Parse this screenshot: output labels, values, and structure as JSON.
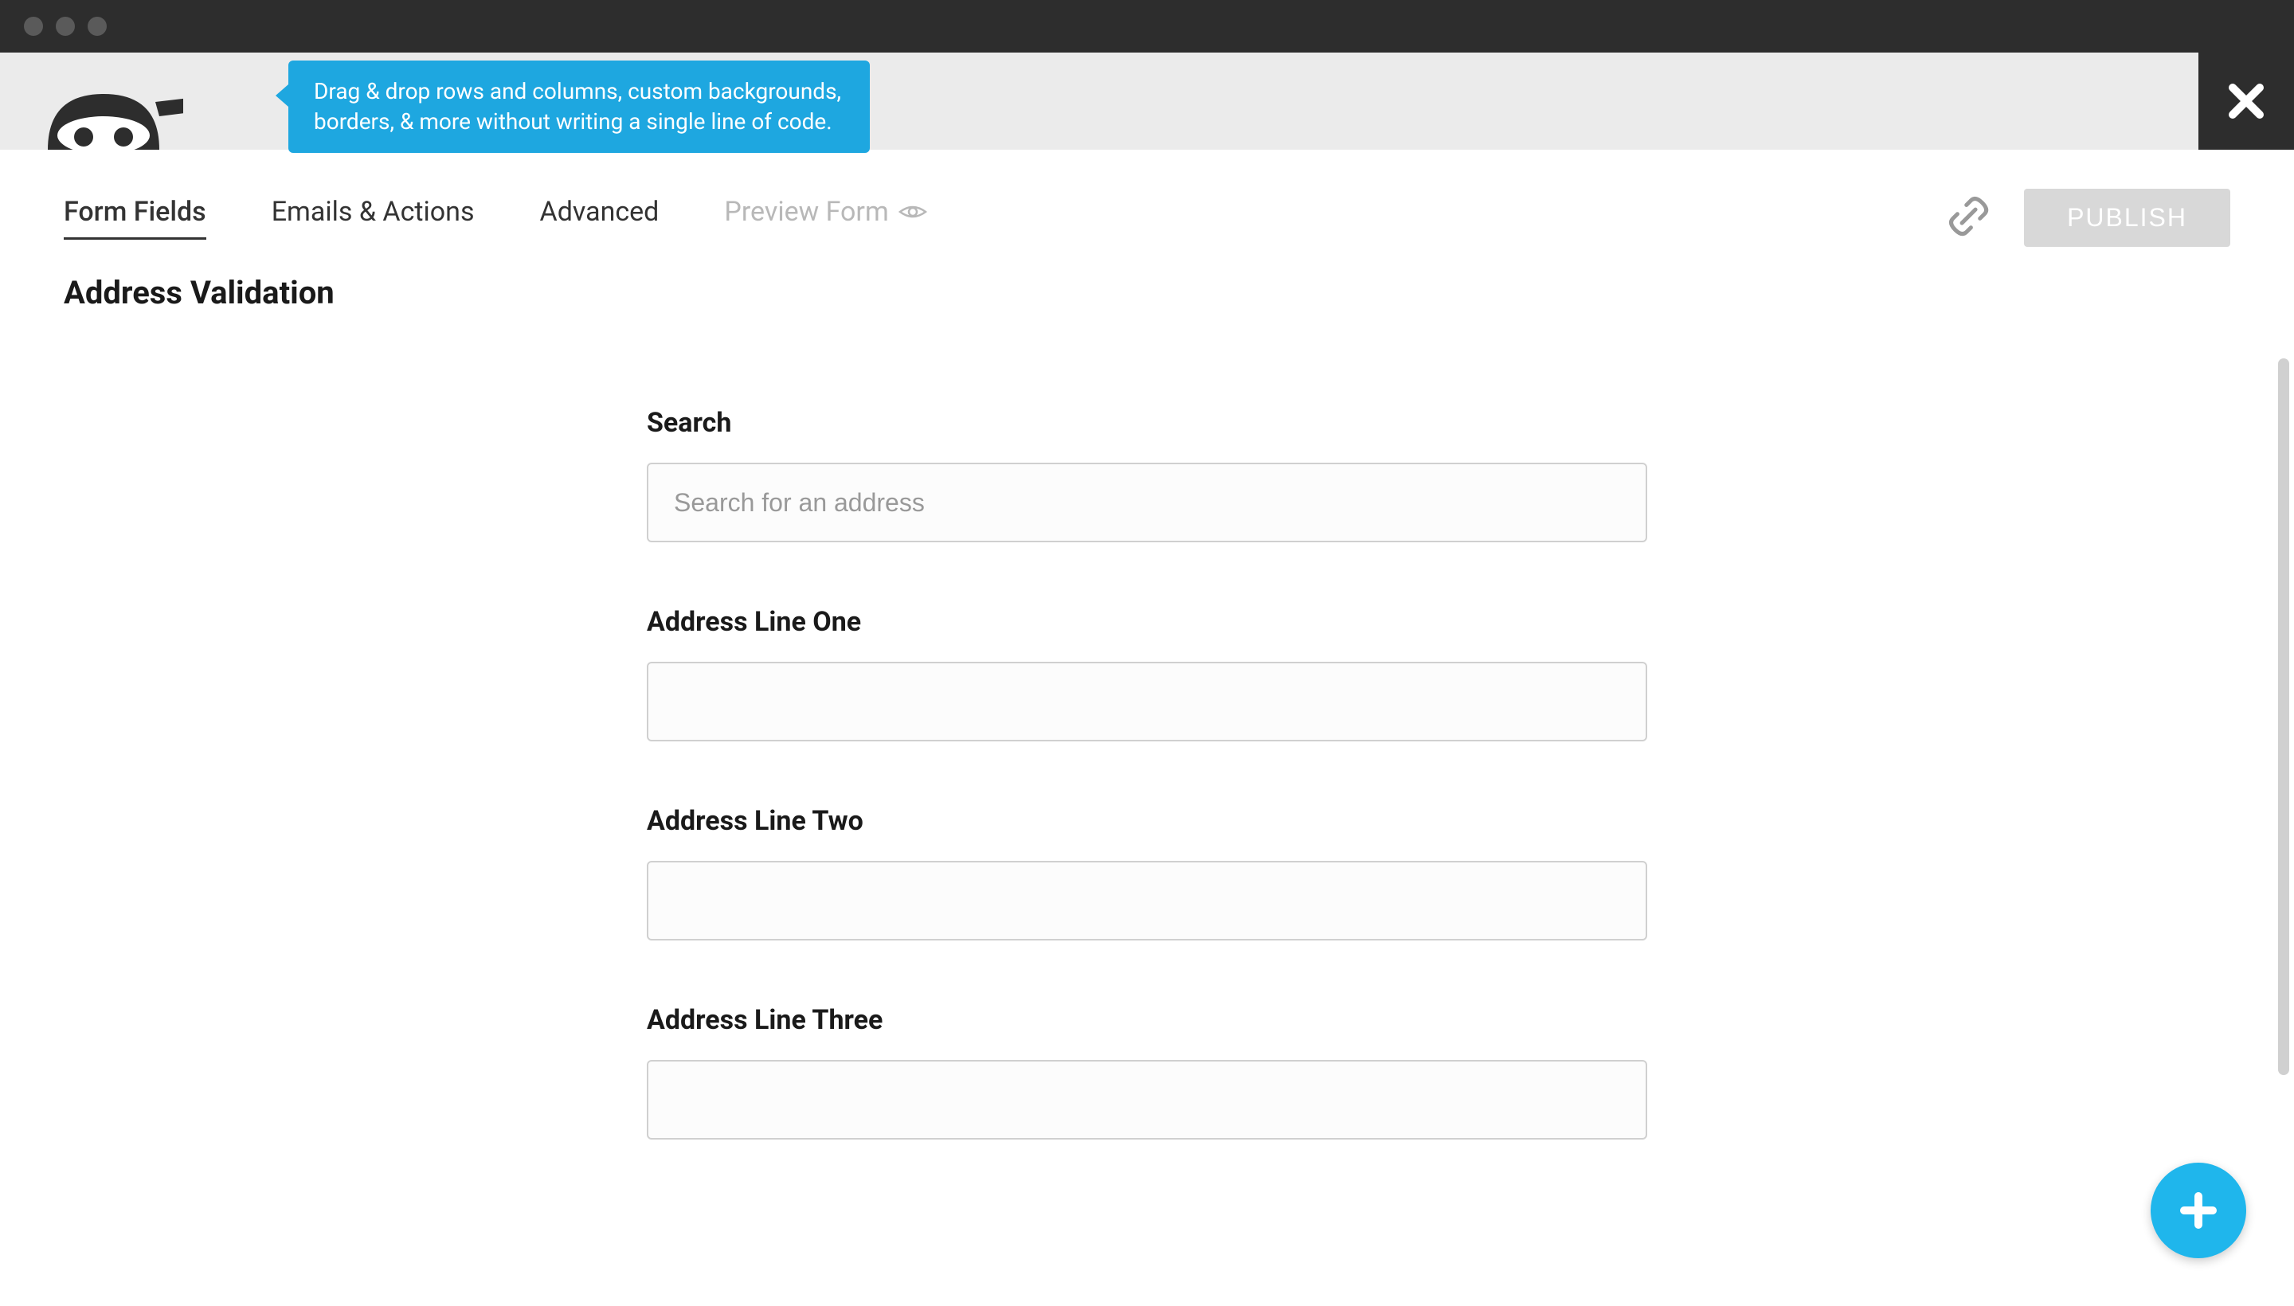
{
  "tooltip": {
    "text": "Drag & drop rows and columns, custom backgrounds, borders, & more without writing a single line of code."
  },
  "nav": {
    "tabs": [
      {
        "label": "Form Fields",
        "active": true
      },
      {
        "label": "Emails & Actions",
        "active": false
      },
      {
        "label": "Advanced",
        "active": false
      },
      {
        "label": "Preview Form",
        "active": false,
        "disabled": true
      }
    ],
    "publish_label": "PUBLISH"
  },
  "page": {
    "title": "Address Validation"
  },
  "form": {
    "fields": [
      {
        "label": "Search",
        "placeholder": "Search for an address",
        "value": ""
      },
      {
        "label": "Address Line One",
        "placeholder": "",
        "value": ""
      },
      {
        "label": "Address Line Two",
        "placeholder": "",
        "value": ""
      },
      {
        "label": "Address Line Three",
        "placeholder": "",
        "value": ""
      }
    ]
  }
}
